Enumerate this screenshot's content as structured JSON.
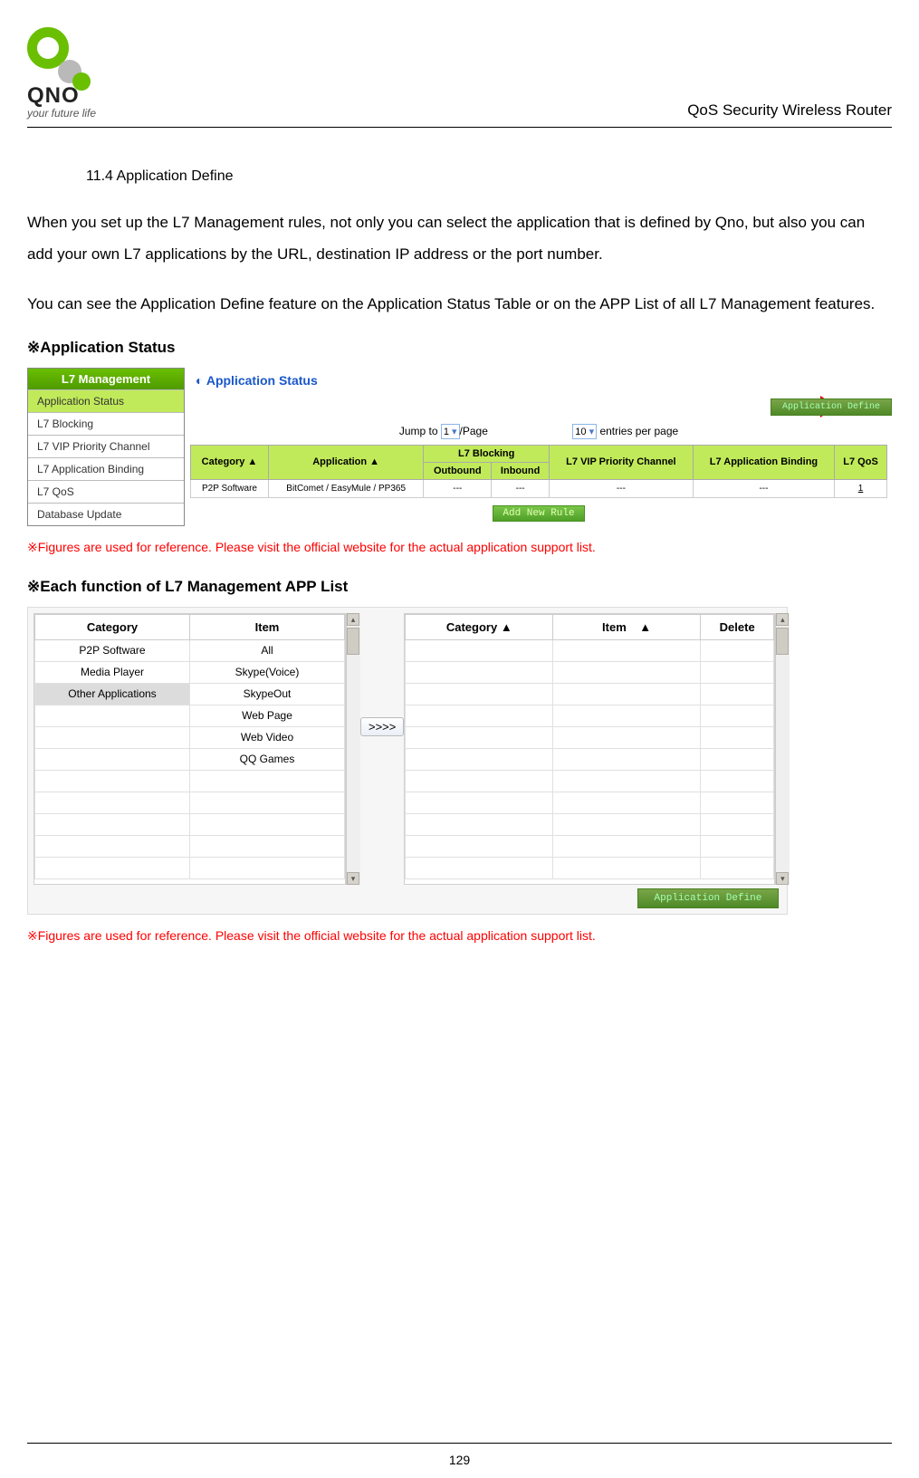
{
  "header": {
    "brand": "QNO",
    "tagline": "your future life",
    "doc_title": "QoS Security Wireless Router"
  },
  "section": {
    "number_title": "11.4 Application Define",
    "para1": "When you set up the L7 Management rules, not only you can select the application that is defined by Qno, but also you can add your own L7 applications by the URL, destination IP address or the port number.",
    "para2": "You can see the Application Define feature on the Application Status Table or on the APP List of all L7 Management features."
  },
  "sub1_heading": "※Application Status",
  "side_menu": {
    "title": "L7 Management",
    "items": [
      "Application Status",
      "L7 Blocking",
      "L7 VIP Priority Channel",
      "L7 Application Binding",
      "L7 QoS",
      "Database Update"
    ]
  },
  "status_panel": {
    "title": "Application Status",
    "app_define_btn": "Application Define",
    "jump_label1": "Jump to",
    "jump_val": "1",
    "jump_label2": "/Page",
    "entries_val": "10",
    "entries_label": "entries per page",
    "headers": {
      "category": "Category ▲",
      "application": "Application ▲",
      "l7blocking": "L7 Blocking",
      "outbound": "Outbound",
      "inbound": "Inbound",
      "vip": "L7 VIP Priority Channel",
      "binding": "L7 Application Binding",
      "qos": "L7 QoS"
    },
    "row": {
      "category": "P2P Software",
      "application": "BitComet / EasyMule / PP365",
      "outbound": "---",
      "inbound": "---",
      "vip": "---",
      "binding": "---",
      "qos": "1"
    },
    "add_rule_btn": "Add New Rule"
  },
  "note1": "※Figures are used for reference. Please visit the official website for the actual application support list.",
  "sub2_heading": "※Each function of L7 Management APP List",
  "applist": {
    "left_headers": {
      "category": "Category",
      "item": "Item"
    },
    "right_headers": {
      "category": "Category ▲",
      "item": "Item    ▲",
      "delete": "Delete"
    },
    "categories": [
      "P2P Software",
      "Media Player",
      "Other Applications"
    ],
    "items": [
      "All",
      "Skype(Voice)",
      "SkypeOut",
      "Web Page",
      "Web Video",
      "QQ Games"
    ],
    "move_btn": ">>>>",
    "app_define_btn": "Application Define"
  },
  "note2": "※Figures are used for reference. Please visit the official website for the actual application support list.",
  "page_number": "129"
}
